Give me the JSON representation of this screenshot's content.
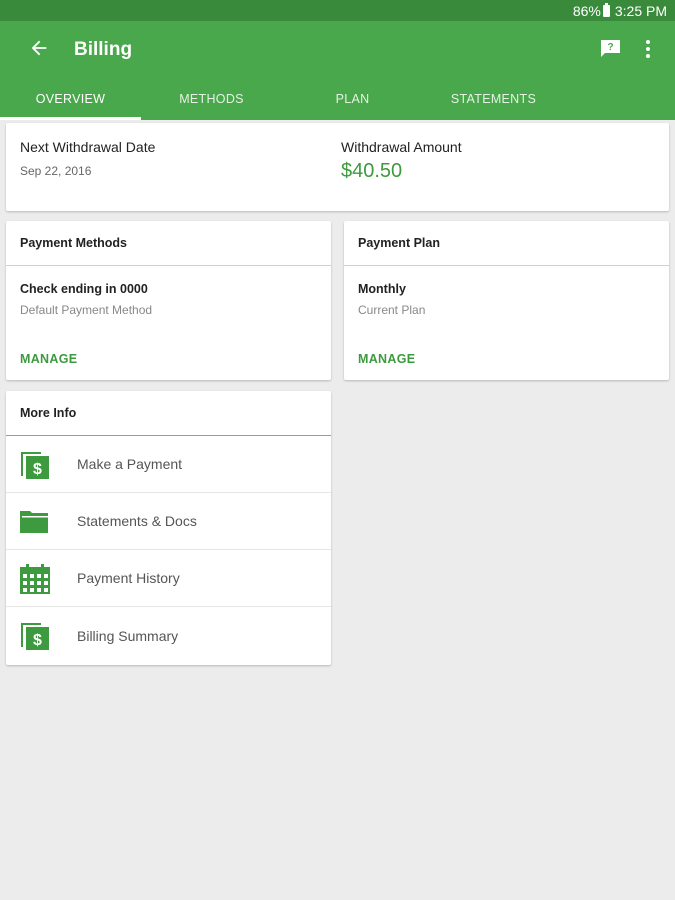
{
  "status": {
    "battery": "86%",
    "time": "3:25 PM"
  },
  "app_bar": {
    "title": "Billing",
    "icons": [
      "back-arrow-icon",
      "feedback-icon",
      "more-vert-icon"
    ]
  },
  "tabs": [
    {
      "label": "OVERVIEW",
      "active": true
    },
    {
      "label": "METHODS",
      "active": false
    },
    {
      "label": "PLAN",
      "active": false
    },
    {
      "label": "STATEMENTS",
      "active": false
    }
  ],
  "summary": {
    "next_label": "Next Withdrawal Date",
    "next_value": "Sep 22, 2016",
    "amount_label": "Withdrawal Amount",
    "amount_value": "$40.50"
  },
  "payment_methods": {
    "header": "Payment Methods",
    "line1": "Check ending in 0000",
    "line2": "Default Payment Method",
    "action": "MANAGE"
  },
  "payment_plan": {
    "header": "Payment Plan",
    "line1": "Monthly",
    "line2": "Current Plan",
    "action": "MANAGE"
  },
  "more_info": {
    "header": "More Info",
    "items": [
      {
        "label": "Make a Payment",
        "icon": "dollar-document-icon"
      },
      {
        "label": "Statements & Docs",
        "icon": "folder-icon"
      },
      {
        "label": "Payment History",
        "icon": "calendar-icon"
      },
      {
        "label": "Billing Summary",
        "icon": "dollar-document-icon"
      }
    ]
  },
  "colors": {
    "primary": "#4aa84c",
    "status_bar": "#3a8a3c",
    "accent_text": "#3d9a3f",
    "background": "#ececec"
  }
}
